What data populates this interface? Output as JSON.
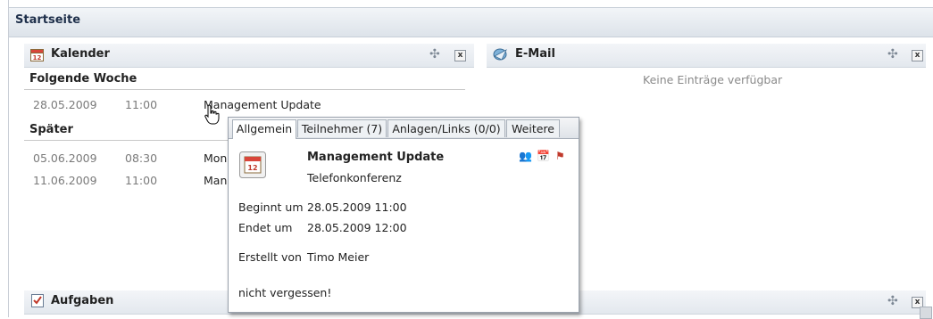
{
  "page": {
    "title": "Startseite"
  },
  "calendar": {
    "title": "Kalender",
    "section_next_week": "Folgende Woche",
    "section_later": "Später",
    "next_week": [
      {
        "date": "28.05.2009",
        "time": "11:00",
        "subject": "Management Update"
      }
    ],
    "later": [
      {
        "date": "05.06.2009",
        "time": "08:30",
        "subject": "Mona"
      },
      {
        "date": "11.06.2009",
        "time": "11:00",
        "subject": "Mana"
      }
    ]
  },
  "email": {
    "title": "E-Mail",
    "empty_text": "Keine Einträge verfügbar"
  },
  "tasks": {
    "title": "Aufgaben"
  },
  "popup": {
    "tabs": [
      "Allgemein",
      "Teilnehmer (7)",
      "Anlagen/Links (0/0)",
      "Weitere"
    ],
    "subject": "Management Update",
    "location": "Telefonkonferenz",
    "begin_label": "Beginnt um",
    "begin_value": "28.05.2009 11:00",
    "end_label": "Endet um",
    "end_value": "28.05.2009 12:00",
    "creator_label": "Erstellt von",
    "creator_value": "Timo Meier",
    "note": "nicht vergessen!"
  },
  "icons": {
    "calendar": "calendar-icon",
    "email": "email-icon",
    "tasks": "checklist-icon",
    "move": "move-icon",
    "close": "close-icon",
    "cursor": "hand-cursor-icon"
  }
}
